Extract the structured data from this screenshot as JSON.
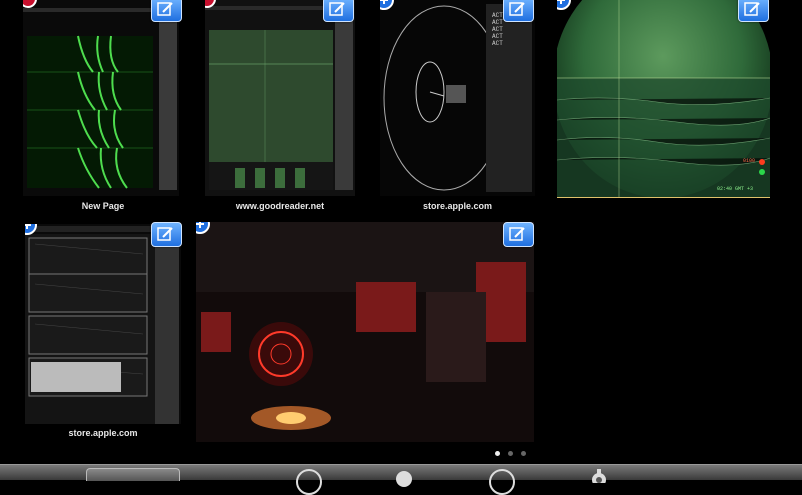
{
  "tabs": [
    {
      "title": "New Page",
      "action": "edit"
    },
    {
      "title": "www.goodreader.net",
      "action": "edit"
    },
    {
      "title": "store.apple.com",
      "action": "edit"
    },
    {
      "title": "",
      "action": "edit"
    },
    {
      "title": "store.apple.com",
      "action": "edit"
    },
    {
      "title": "",
      "action": "edit"
    }
  ],
  "thumb3_panel_tags": [
    "ACT",
    "ACT",
    "ACT",
    "ACT",
    "ACT"
  ],
  "thumb4_overlay": {
    "readout_red": "0100",
    "readout_green": "02:40  GMT +3"
  },
  "pager": {
    "pages": 3,
    "current": 1
  },
  "toolbar": {
    "icons": [
      "tabs-button",
      "reload-icon",
      "record-icon",
      "dot-icon",
      "settings-gear-icon"
    ]
  }
}
